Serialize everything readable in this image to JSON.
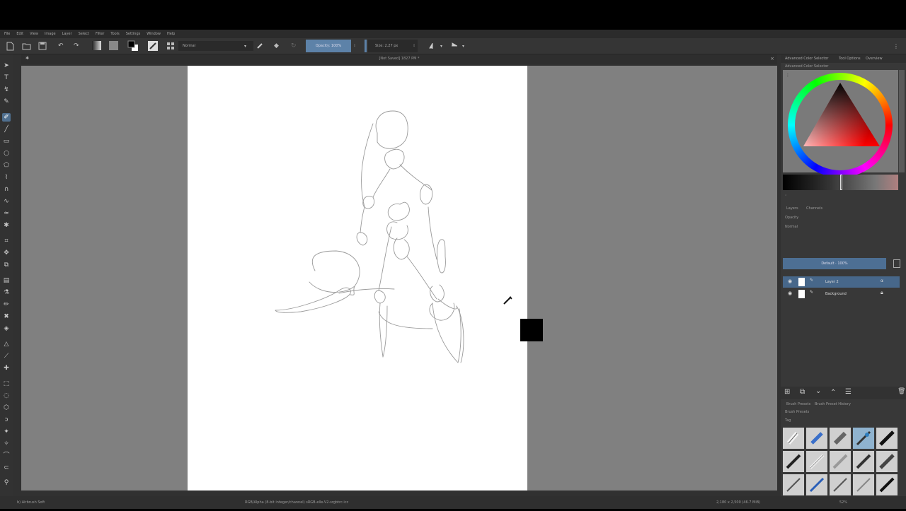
{
  "menus": [
    "File",
    "Edit",
    "View",
    "Image",
    "Layer",
    "Select",
    "Filter",
    "Tools",
    "Settings",
    "Window",
    "Help"
  ],
  "toolbar": {
    "blend_mode": "Normal",
    "opacity": "Opacity: 100%",
    "size": "Size: 2.27 px"
  },
  "document": {
    "title": "[Not Saved] 1827 PM *"
  },
  "statusbar": {
    "left": "b) Airbrush Soft",
    "center": "RGB/Alpha (8-bit integer/channel)  sRGB-elle-V2-srgbtrc.icc",
    "right": "2,180 x 2,500 (46.7 MiB)",
    "zoom": "52%"
  },
  "docker": {
    "tabs": [
      "Advanced Color Selector",
      "Tool Options",
      "Overview"
    ],
    "section_label": "Advanced Color Selector",
    "layers_tabs": [
      "Layers",
      "Channels"
    ],
    "opacity_label": "Opacity",
    "mode_label": "Normal",
    "layer_banner": "Default · 100%",
    "layers": [
      {
        "name": "Layer 2",
        "selected": true
      },
      {
        "name": "Background",
        "selected": false
      }
    ],
    "presets_tabs": [
      "Brush Presets",
      "Brush Preset History"
    ],
    "presets_label": "Brush Presets",
    "tag_label": "Tag"
  },
  "colors": {
    "accent": "#4f6f8f",
    "canvas_bg": "#808080",
    "foreground_color": "#000000"
  }
}
